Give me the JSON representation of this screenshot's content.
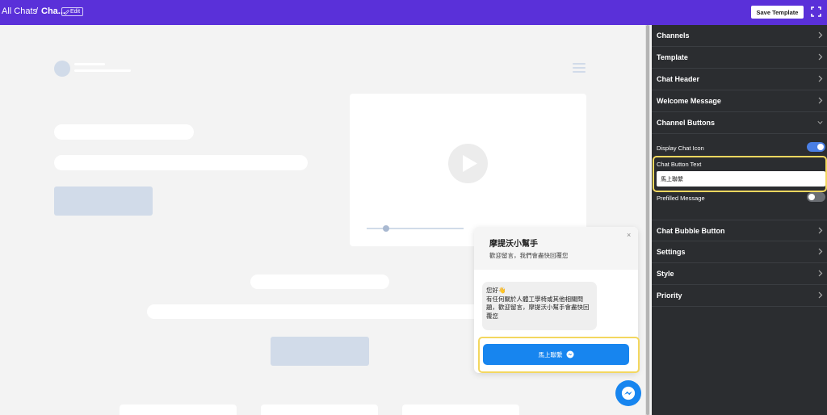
{
  "topbar": {
    "breadcrumb_all": "All Chats",
    "breadcrumb_separator": "/",
    "breadcrumb_current": "Cha...",
    "edit_label": "Edit",
    "save_label": "Save Template"
  },
  "chat_widget": {
    "title": "摩提沃小幫手",
    "subtitle": "歡迎留言，我們會盡快回覆您",
    "close_symbol": "×",
    "message_line1": "您好👋",
    "message_body": "有任何關於人體工學椅或其他相關問題，歡迎留言，摩提沃小幫手會盡快回覆您",
    "button_label": "馬上聯繫"
  },
  "panel": {
    "sections_top": [
      {
        "label": "Channels"
      },
      {
        "label": "Template"
      },
      {
        "label": "Chat Header"
      },
      {
        "label": "Welcome Message"
      },
      {
        "label": "Channel Buttons"
      }
    ],
    "display_chat_icon": {
      "label": "Display Chat Icon",
      "on": true
    },
    "chat_button_text": {
      "label": "Chat Button Text",
      "value": "馬上聯繫"
    },
    "prefilled_message": {
      "label": "Prefilled Message",
      "on": false
    },
    "sections_bottom": [
      {
        "label": "Chat Bubble Button"
      },
      {
        "label": "Settings"
      },
      {
        "label": "Style"
      },
      {
        "label": "Priority"
      }
    ]
  },
  "colors": {
    "topbar": "#5a30d9",
    "panel_bg": "#2b2d30",
    "toggle_on": "#4a7fe5",
    "toggle_off": "#6b6e73",
    "highlight": "#f3d75f",
    "chat_button": "#1785ef",
    "skeleton_blue": "#d1dbe9"
  },
  "icons": [
    "edit-icon",
    "fullscreen-icon",
    "hamburger-icon",
    "play-icon",
    "close-icon",
    "messenger-icon",
    "chevron-right-icon",
    "chevron-down-icon"
  ]
}
